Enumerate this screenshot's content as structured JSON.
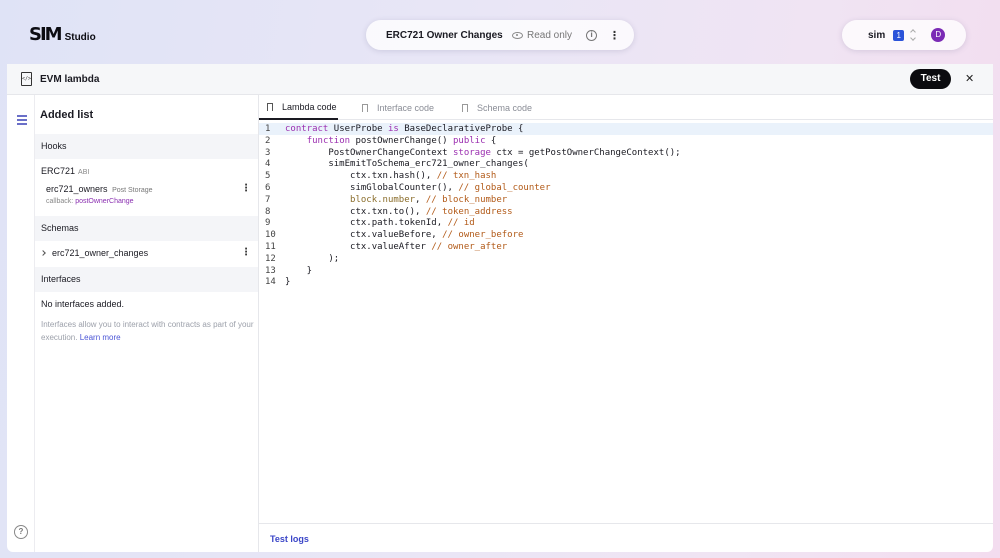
{
  "brand": {
    "mark": "SIM",
    "product": "Studio"
  },
  "project": {
    "title": "ERC721 Owner Changes (In...",
    "mode": "Read only"
  },
  "user": {
    "name": "sim",
    "badge": "1",
    "avatar_initial": "D"
  },
  "panel": {
    "title": "EVM lambda",
    "test_label": "Test",
    "close_label": "✕"
  },
  "sidebar": {
    "title": "Added list",
    "hooks_label": "Hooks",
    "abi_name": "ERC721",
    "abi_tag": "ABI",
    "hook_name": "erc721_owners",
    "hook_type": "Post Storage",
    "callback_label": "callback:",
    "callback_fn": "postOwnerChange",
    "schemas_label": "Schemas",
    "schema_name": "erc721_owner_changes",
    "interfaces_label": "Interfaces",
    "no_interfaces": "No interfaces added.",
    "interfaces_desc": "Interfaces allow you to interact with contracts as part of your execution.",
    "learn_more": "Learn more"
  },
  "tabs": [
    {
      "label": "Lambda code",
      "active": true
    },
    {
      "label": "Interface code",
      "active": false
    },
    {
      "label": "Schema code",
      "active": false
    }
  ],
  "code_lines": [
    [
      [
        "kw",
        "contract"
      ],
      [
        "pl",
        " UserProbe "
      ],
      [
        "kw",
        "is"
      ],
      [
        "pl",
        " BaseDeclarativeProbe {"
      ]
    ],
    [
      [
        "pl",
        "    "
      ],
      [
        "kw",
        "function"
      ],
      [
        "pl",
        " postOwnerChange() "
      ],
      [
        "kw",
        "public"
      ],
      [
        "pl",
        " {"
      ]
    ],
    [
      [
        "pl",
        "        PostOwnerChangeContext "
      ],
      [
        "kw",
        "storage"
      ],
      [
        "pl",
        " ctx = getPostOwnerChangeContext();"
      ]
    ],
    [
      [
        "pl",
        "        simEmitToSchema_erc721_owner_changes("
      ]
    ],
    [
      [
        "pl",
        "            ctx.txn.hash(), "
      ],
      [
        "cm",
        "// txn_hash"
      ]
    ],
    [
      [
        "pl",
        "            simGlobalCounter(), "
      ],
      [
        "cm",
        "// global_counter"
      ]
    ],
    [
      [
        "pr",
        "            block.number"
      ],
      [
        "pl",
        ", "
      ],
      [
        "cm",
        "// block_number"
      ]
    ],
    [
      [
        "pl",
        "            ctx.txn.to(), "
      ],
      [
        "cm",
        "// token_address"
      ]
    ],
    [
      [
        "pl",
        "            ctx.path.tokenId, "
      ],
      [
        "cm",
        "// id"
      ]
    ],
    [
      [
        "pl",
        "            ctx.valueBefore, "
      ],
      [
        "cm",
        "// owner_before"
      ]
    ],
    [
      [
        "pl",
        "            ctx.valueAfter "
      ],
      [
        "cm",
        "// owner_after"
      ]
    ],
    [
      [
        "pl",
        "        );"
      ]
    ],
    [
      [
        "pl",
        "    }"
      ]
    ],
    [
      [
        "pl",
        "}"
      ]
    ]
  ],
  "logs_label": "Test logs"
}
